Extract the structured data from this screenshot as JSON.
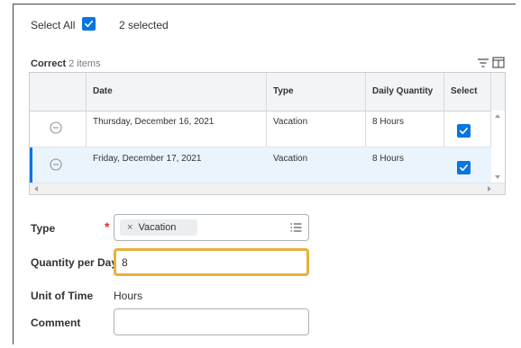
{
  "select_all": {
    "label": "Select All",
    "checked": true,
    "count_text": "2 selected"
  },
  "grid": {
    "title": "Correct",
    "count": "2 items",
    "columns": [
      "Date",
      "Type",
      "Daily Quantity",
      "Select"
    ],
    "rows": [
      {
        "date": "Thursday, December 16, 2021",
        "type": "Vacation",
        "quantity": "8 Hours",
        "selected": true,
        "highlighted": false
      },
      {
        "date": "Friday, December 17, 2021",
        "type": "Vacation",
        "quantity": "8 Hours",
        "selected": true,
        "highlighted": true
      }
    ]
  },
  "form": {
    "type_label": "Type",
    "type_value": "Vacation",
    "quantity_label": "Quantity per Day",
    "quantity_value": "8",
    "unit_label": "Unit of Time",
    "unit_value": "Hours",
    "comment_label": "Comment",
    "comment_value": ""
  },
  "colors": {
    "accent": "#0875e1",
    "focus": "#e9b13a",
    "required": "#de2e21"
  }
}
